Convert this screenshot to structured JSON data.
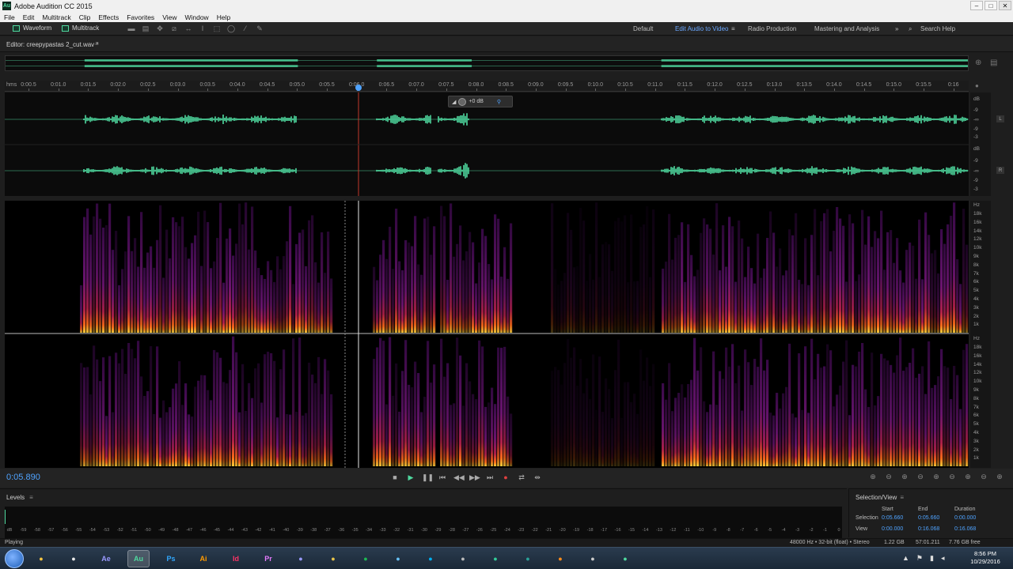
{
  "window": {
    "title": "Adobe Audition CC 2015",
    "app_badge": "Au",
    "controls": [
      "–",
      "□",
      "✕"
    ]
  },
  "menu": [
    "File",
    "Edit",
    "Multitrack",
    "Clip",
    "Effects",
    "Favorites",
    "View",
    "Window",
    "Help"
  ],
  "toolbar": {
    "waveform_label": "Waveform",
    "multitrack_label": "Multitrack",
    "workspaces": [
      "Default",
      "Edit Audio to Video",
      "Radio Production",
      "Mastering and Analysis"
    ],
    "active_workspace": "Edit Audio to Video",
    "workspace_menu_icon": "≡",
    "more_icon": "»",
    "search_label": "Search Help"
  },
  "editor": {
    "tab_label": "Editor: creepypastas 2_cut.wav *",
    "menu_icon": "≡"
  },
  "ruler": {
    "units": "hms",
    "ticks": [
      "0:00.5",
      "0:01.0",
      "0:01.5",
      "0:02.0",
      "0:02.5",
      "0:03.0",
      "0:03.5",
      "0:04.0",
      "0:04.5",
      "0:05.0",
      "0:05.5",
      "0:06.0",
      "0:06.5",
      "0:07.0",
      "0:07.5",
      "0:08.0",
      "0:08.5",
      "0:09.0",
      "0:09.5",
      "0:10.0",
      "0:10.5",
      "0:11.0",
      "0:11.5",
      "0:12.0",
      "0:12.5",
      "0:13.0",
      "0:13.5",
      "0:14.0",
      "0:14.5",
      "0:15.0",
      "0:15.5",
      "0:16"
    ]
  },
  "hud": {
    "gain": "+0 dB"
  },
  "db_scale": {
    "unit": "dB",
    "labels": [
      "-9",
      "-∞",
      "-9",
      "-3"
    ],
    "channels": [
      "L",
      "R"
    ]
  },
  "hz_scale": {
    "unit": "Hz",
    "labels": [
      "18k",
      "16k",
      "14k",
      "12k",
      "10k",
      "9k",
      "8k",
      "7k",
      "6k",
      "5k",
      "4k",
      "3k",
      "2k",
      "1k"
    ]
  },
  "transport": {
    "timecode": "0:05.890",
    "controls": [
      "■",
      "▶",
      "❚❚",
      "⏮",
      "◀◀",
      "▶▶",
      "⏭",
      "●",
      "⇄",
      "⇹"
    ],
    "zoom_tools": [
      "⊕",
      "⊖",
      "⊕",
      "⊖",
      "⊕",
      "⊖",
      "⊕",
      "⊖",
      "⊕",
      "⊕"
    ]
  },
  "levels": {
    "title": "Levels",
    "menu_icon": "≡",
    "scale": [
      "dB",
      "-59",
      "-58",
      "-57",
      "-56",
      "-55",
      "-54",
      "-53",
      "-52",
      "-51",
      "-50",
      "-49",
      "-48",
      "-47",
      "-46",
      "-45",
      "-44",
      "-43",
      "-42",
      "-41",
      "-40",
      "-39",
      "-38",
      "-37",
      "-36",
      "-35",
      "-34",
      "-33",
      "-32",
      "-31",
      "-30",
      "-29",
      "-28",
      "-27",
      "-26",
      "-25",
      "-24",
      "-23",
      "-22",
      "-21",
      "-20",
      "-19",
      "-18",
      "-17",
      "-16",
      "-15",
      "-14",
      "-13",
      "-12",
      "-11",
      "-10",
      "-9",
      "-8",
      "-7",
      "-6",
      "-5",
      "-4",
      "-3",
      "-2",
      "-1",
      "0"
    ]
  },
  "selection_view": {
    "title": "Selection/View",
    "menu_icon": "≡",
    "columns": [
      "Start",
      "End",
      "Duration"
    ],
    "rows": [
      {
        "label": "Selection",
        "start": "0:05.660",
        "end": "0:05.660",
        "duration": "0:00.000"
      },
      {
        "label": "View",
        "start": "0:00.000",
        "end": "0:16.068",
        "duration": "0:16.068"
      }
    ]
  },
  "status": {
    "state": "Playing",
    "format": "48000 Hz • 32-bit (float) • Stereo",
    "file_size": "1.22 GB",
    "duration": "57:01.211",
    "free_space": "7.76 GB free"
  },
  "taskbar": {
    "apps": [
      "",
      "",
      "Ae",
      "Au",
      "Ps",
      "Ai",
      "Id",
      "Pr",
      "",
      "",
      "",
      "",
      "",
      "",
      "",
      "",
      "",
      "",
      ""
    ],
    "clock_time": "8:56 PM",
    "clock_date": "10/29/2016"
  },
  "colors": {
    "waveform": "#4fd99f",
    "accent_blue": "#4fa3ff",
    "playhead": "#c0392b",
    "record": "#e04040"
  }
}
